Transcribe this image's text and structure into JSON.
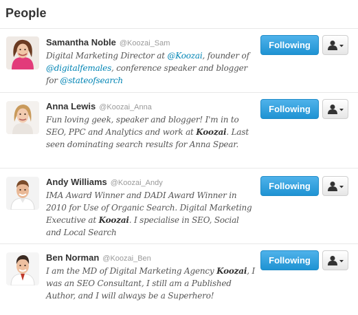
{
  "panel": {
    "title": "People"
  },
  "people": [
    {
      "name": "Samantha Noble",
      "handle": "@Koozai_Sam",
      "bio": [
        {
          "t": "Digital Marketing Director at "
        },
        {
          "t": "@Koozai",
          "k": "mention"
        },
        {
          "t": ", founder of "
        },
        {
          "t": "@digitalfemales",
          "k": "mention"
        },
        {
          "t": ", conference speaker and blogger for "
        },
        {
          "t": "@stateofsearch",
          "k": "mention"
        }
      ],
      "follow_label": "Following",
      "avatar_icon": "avatar-samantha-noble"
    },
    {
      "name": "Anna Lewis",
      "handle": "@Koozai_Anna",
      "bio": [
        {
          "t": "Fun loving geek, speaker and blogger! I'm in to SEO, PPC and Analytics and work at "
        },
        {
          "t": "Koozai",
          "k": "strong"
        },
        {
          "t": ". Last seen dominating search results for Anna Spear."
        }
      ],
      "follow_label": "Following",
      "avatar_icon": "avatar-anna-lewis"
    },
    {
      "name": "Andy Williams",
      "handle": "@Koozai_Andy",
      "bio": [
        {
          "t": "IMA Award Winner and DADI Award Winner in 2010 for Use of Organic Search. Digital Marketing Executive at "
        },
        {
          "t": "Koozai",
          "k": "strong"
        },
        {
          "t": ". I specialise in SEO, Social and Local Search"
        }
      ],
      "follow_label": "Following",
      "avatar_icon": "avatar-andy-williams"
    },
    {
      "name": "Ben Norman",
      "handle": "@Koozai_Ben",
      "bio": [
        {
          "t": "I am the MD of Digital Marketing Agency "
        },
        {
          "t": "Koozai",
          "k": "strong"
        },
        {
          "t": ", I was an SEO Consultant, I still am a Published Author, and I will always be a Superhero!"
        }
      ],
      "follow_label": "Following",
      "avatar_icon": "avatar-ben-norman"
    }
  ],
  "user_menu_icon": "person-dropdown-icon",
  "colors": {
    "follow_button": "#2aa0e0",
    "mention_link": "#0084b4",
    "divider": "#e8e8e8"
  }
}
